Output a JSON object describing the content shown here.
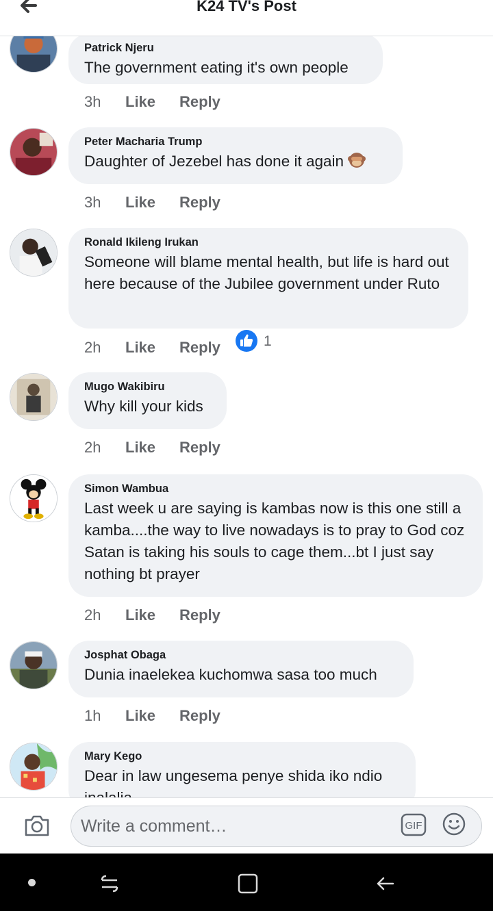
{
  "header": {
    "title": "K24 TV's Post",
    "back_icon": "arrow-left-icon"
  },
  "comments": [
    {
      "author": "Patrick Njeru",
      "text": "The government eating it's own people",
      "time": "3h",
      "like": "Like",
      "reply": "Reply"
    },
    {
      "author": "Peter Macharia Trump",
      "text": "Daughter of Jezebel has done it again",
      "emoji": "see-no-evil-monkey-emoji",
      "time": "3h",
      "like": "Like",
      "reply": "Reply"
    },
    {
      "author": "Ronald Ikileng Irukan",
      "text": "Someone will blame mental health, but life is hard out here because of the Jubilee government under Ruto",
      "time": "2h",
      "like": "Like",
      "reply": "Reply",
      "reaction": {
        "icon": "thumbs-up-icon",
        "count": "1"
      }
    },
    {
      "author": "Mugo Wakibiru",
      "text": "Why kill your kids",
      "time": "2h",
      "like": "Like",
      "reply": "Reply"
    },
    {
      "author": "Simon Wambua",
      "text": "Last week u are saying is kambas now is this one still a kamba....the way to live nowadays is to pray to God coz Satan is taking his souls to cage them...bt I just say nothing bt prayer",
      "time": "2h",
      "like": "Like",
      "reply": "Reply"
    },
    {
      "author": "Josphat Obaga",
      "text": "Dunia inaelekea kuchomwa sasa too much",
      "time": "1h",
      "like": "Like",
      "reply": "Reply"
    },
    {
      "author": "Mary Kego",
      "text": "Dear in law ungesema penye shida iko ndio inalalia"
    }
  ],
  "composer": {
    "placeholder": "Write a comment…",
    "camera_icon": "camera-icon",
    "gif_icon": "gif-icon",
    "emoji_icon": "smiley-icon"
  },
  "colors": {
    "bubble": "#f0f2f5",
    "meta_text": "#65676b",
    "text": "#1c1e21",
    "reaction_blue": "#1877f2",
    "navbar": "#000000"
  }
}
